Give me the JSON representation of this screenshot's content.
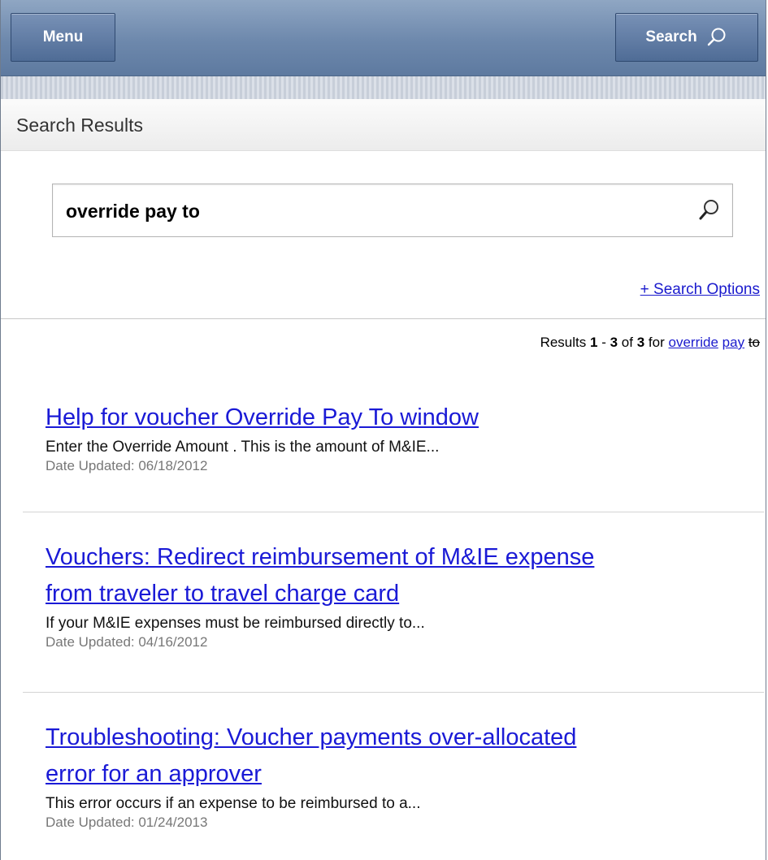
{
  "header": {
    "menu_label": "Menu",
    "search_label": "Search"
  },
  "page": {
    "title": "Search Results"
  },
  "search": {
    "query": "override pay to",
    "options_link": "+ Search Options"
  },
  "results_summary": {
    "prefix": "Results",
    "start": "1",
    "dash": "-",
    "end": "3",
    "of_label": "of",
    "total": "3",
    "for_label": "for",
    "terms": [
      {
        "text": "override",
        "matched": true
      },
      {
        "text": "pay",
        "matched": true
      },
      {
        "text": "to",
        "matched": false
      }
    ]
  },
  "results": [
    {
      "title_lines": [
        "Help for voucher Override Pay To window"
      ],
      "snippet": "Enter the Override Amount . This is the amount of M&IE...",
      "date": "Date Updated: 06/18/2012"
    },
    {
      "title_lines": [
        "Vouchers: Redirect reimbursement of M&IE expense",
        "from traveler to travel charge card"
      ],
      "snippet": "If your M&IE expenses must be reimbursed directly to...",
      "date": "Date Updated: 04/16/2012"
    },
    {
      "title_lines": [
        "Troubleshooting: Voucher payments over-allocated",
        "error for an approver"
      ],
      "snippet": "This error occurs if an expense to be reimbursed to a...",
      "date": "Date Updated: 01/24/2013"
    }
  ],
  "colors": {
    "link": "#1a1ad6",
    "topbar": "#6d88ac",
    "date_text": "#777777"
  },
  "icons": {
    "header_search": "search-icon",
    "box_search": "magnifier-icon"
  }
}
